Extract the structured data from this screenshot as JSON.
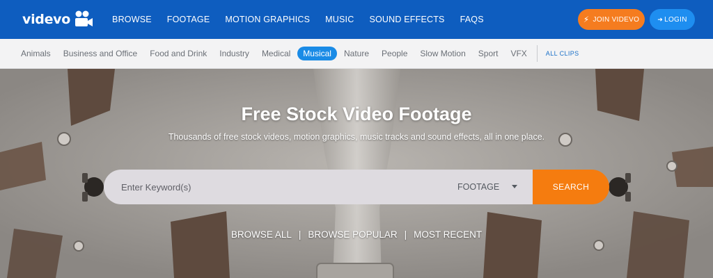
{
  "brand": {
    "name": "videvo",
    "logo_icon": "film-camera-icon"
  },
  "nav": {
    "links": [
      "BROWSE",
      "FOOTAGE",
      "MOTION GRAPHICS",
      "MUSIC",
      "SOUND EFFECTS",
      "FAQS"
    ],
    "join_label": "JOIN VIDEVO",
    "join_icon": "lightning-icon",
    "login_label": "LOGIN",
    "login_icon": "login-icon"
  },
  "categories": {
    "items": [
      "Animals",
      "Business and Office",
      "Food and Drink",
      "Industry",
      "Medical",
      "Musical",
      "Nature",
      "People",
      "Slow Motion",
      "Sport",
      "VFX"
    ],
    "active": "Musical",
    "all_clips_label": "ALL CLIPS"
  },
  "hero": {
    "title": "Free Stock Video Footage",
    "subtitle": "Thousands of free stock videos, motion graphics, music tracks and sound effects, all in one place.",
    "search": {
      "placeholder": "Enter Keyword(s)",
      "type_selected": "FOOTAGE",
      "button_label": "SEARCH"
    },
    "browse_links": [
      "BROWSE ALL",
      "BROWSE POPULAR",
      "MOST RECENT"
    ],
    "separator": "|"
  },
  "colors": {
    "nav_bg": "#0e5dbf",
    "accent_orange": "#f57c0f",
    "accent_blue": "#1a8be6"
  }
}
